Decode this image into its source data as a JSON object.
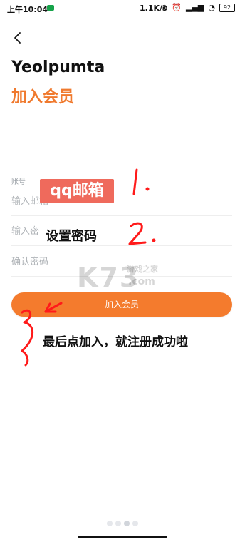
{
  "status_bar": {
    "time": "上午10:04",
    "network_speed": "1.1K/s",
    "battery": "92"
  },
  "header": {
    "app_title": "Yeolpumta",
    "page_title": "加入会员"
  },
  "form": {
    "account_label": "账号",
    "email_placeholder": "输入邮箱",
    "password_placeholder": "输入密",
    "confirm_password_placeholder": "确认密码"
  },
  "actions": {
    "join_button_label": "加入会员"
  },
  "annotations": {
    "qq_email": "qq邮箱",
    "set_password": "设置密码",
    "final_step": "最后点加入，就注册成功啦",
    "step_one": "1.",
    "step_two": "2.",
    "step_three": "3"
  },
  "watermark": {
    "brand": "K73",
    "subtitle": "游戏之家",
    "domain": ".com"
  },
  "colors": {
    "accent": "#f47b2d",
    "annotation_box": "#ef6a5c",
    "stroke": "#ff1a1a"
  }
}
